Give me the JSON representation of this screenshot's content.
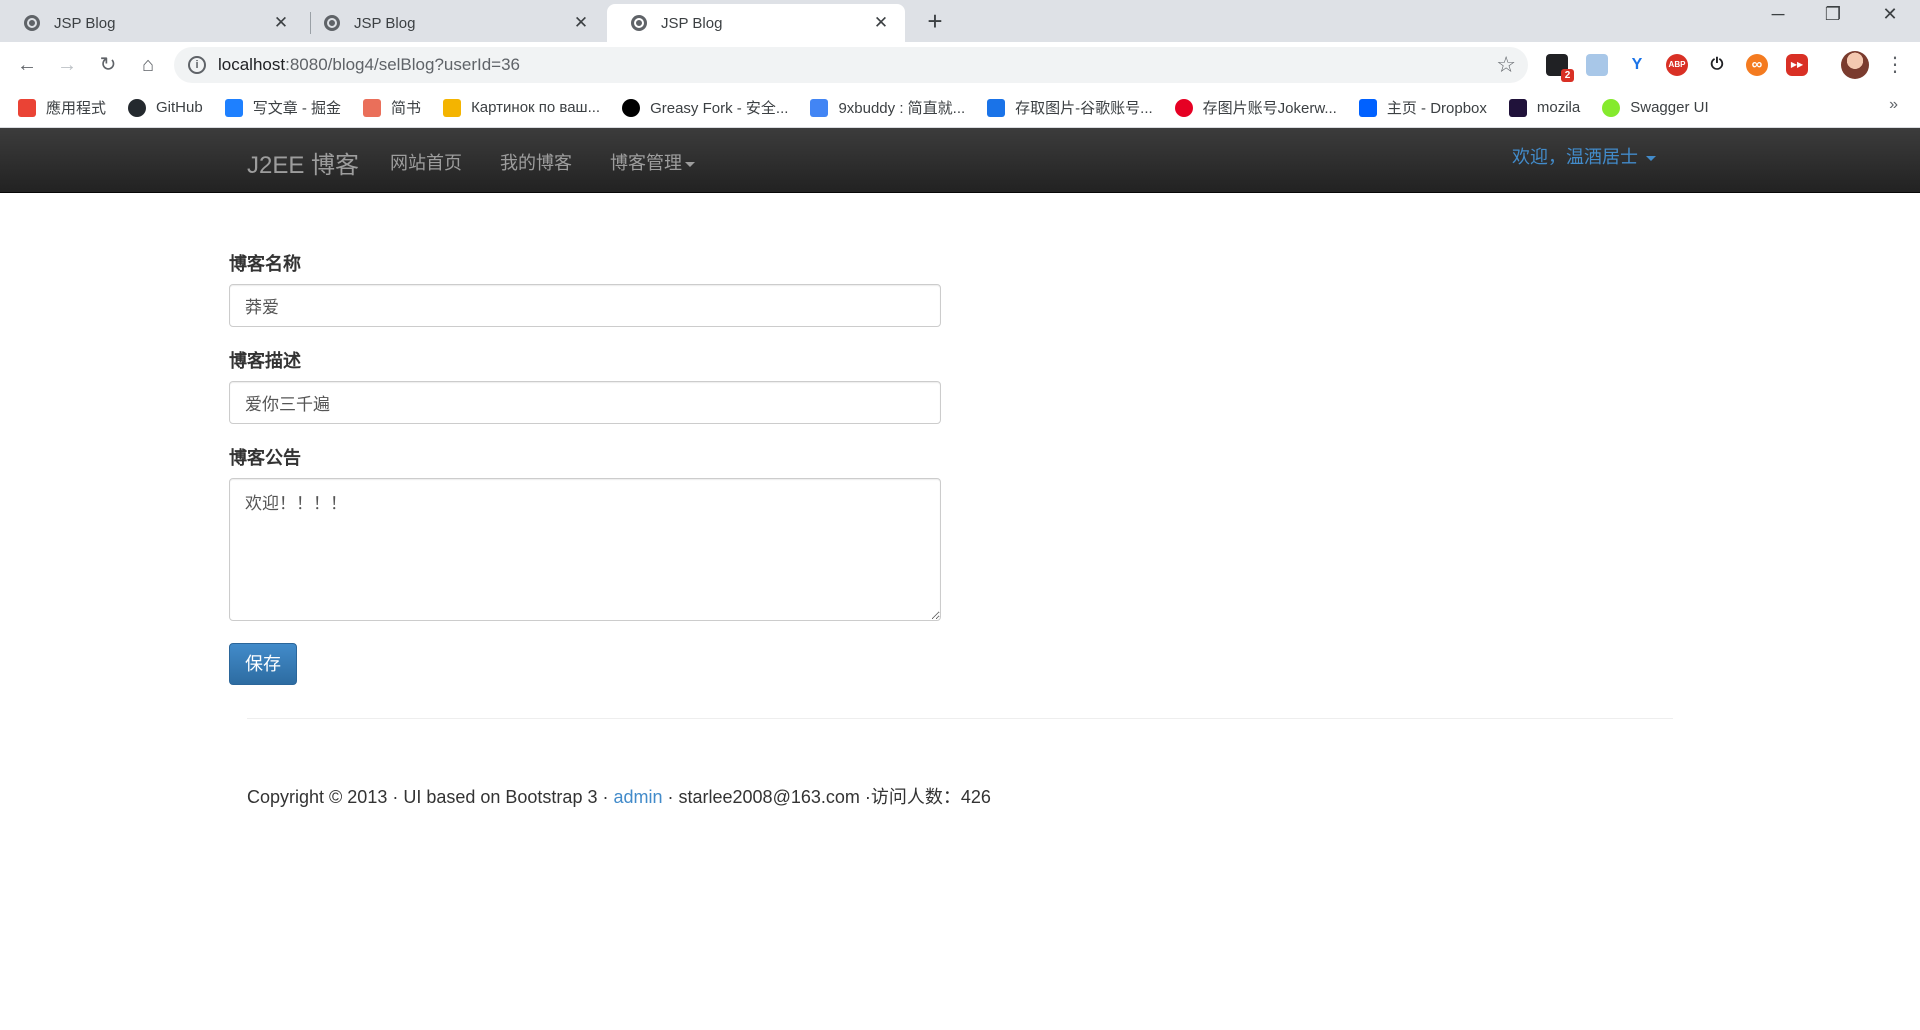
{
  "browser": {
    "tabs": [
      {
        "title": "JSP Blog"
      },
      {
        "title": "JSP Blog"
      },
      {
        "title": "JSP Blog"
      }
    ],
    "new_tab": "+",
    "window_controls": {
      "minimize": "─",
      "restore": "❐",
      "close": "✕"
    },
    "nav": {
      "back": "←",
      "forward": "→",
      "reload": "↻",
      "home": "⌂"
    },
    "address": {
      "host": "localhost",
      "rest": ":8080/blog4/selBlog?userId=36"
    },
    "extensions": [
      {
        "name": "notification-extension-icon",
        "color": "#202124",
        "badge": "2"
      },
      {
        "name": "image-extension-icon",
        "color": "#a8c7e8"
      },
      {
        "name": "vpn-extension-icon",
        "color": "#1a73e8"
      },
      {
        "name": "adblock-icon",
        "color": "#d93025",
        "text": "ABP"
      },
      {
        "name": "power-icon",
        "color": "#ffffff"
      },
      {
        "name": "infinity-icon",
        "color": "#f47b20"
      },
      {
        "name": "video-extension-icon",
        "color": "#d93025"
      }
    ],
    "bookmarks": [
      {
        "label": "應用程式",
        "icon": "apps-grid-icon",
        "color": "#ea4335"
      },
      {
        "label": "GitHub",
        "icon": "github-icon",
        "color": "#24292e"
      },
      {
        "label": "写文章 - 掘金",
        "icon": "juejin-icon",
        "color": "#1e80ff"
      },
      {
        "label": "简书",
        "icon": "jianshu-icon",
        "color": "#ea6f5a"
      },
      {
        "label": "Картинок по ваш...",
        "icon": "image-icon",
        "color": "#f4b400"
      },
      {
        "label": "Greasy Fork - 安全...",
        "icon": "greasyfork-icon",
        "color": "#000000"
      },
      {
        "label": "9xbuddy : 简直就...",
        "icon": "doc-icon",
        "color": "#4285f4"
      },
      {
        "label": "存取图片-谷歌账号...",
        "icon": "imgbb-icon",
        "color": "#1a73e8"
      },
      {
        "label": "存图片账号Jokerw...",
        "icon": "pinterest-icon",
        "color": "#e60023"
      },
      {
        "label": "主页 - Dropbox",
        "icon": "dropbox-icon",
        "color": "#0061ff"
      },
      {
        "label": "mozila",
        "icon": "mozilla-icon",
        "color": "#20123a"
      },
      {
        "label": "Swagger UI",
        "icon": "swagger-icon",
        "color": "#85ea2d"
      }
    ],
    "bookmarks_more": "»"
  },
  "navbar": {
    "brand": "J2EE 博客",
    "links": [
      "网站首页",
      "我的博客",
      "博客管理"
    ],
    "user": "欢迎，温酒居士"
  },
  "form": {
    "name_label": "博客名称",
    "name_value": "莽爱",
    "desc_label": "博客描述",
    "desc_value": "爱你三千遍",
    "notice_label": "博客公告",
    "notice_value": "欢迎！！！！",
    "save_label": "保存"
  },
  "footer": {
    "text1": "Copyright © 2013 · UI based on Bootstrap 3 · ",
    "link": "admin",
    "text2": " · starlee2008@163.com ·访问人数：426"
  }
}
